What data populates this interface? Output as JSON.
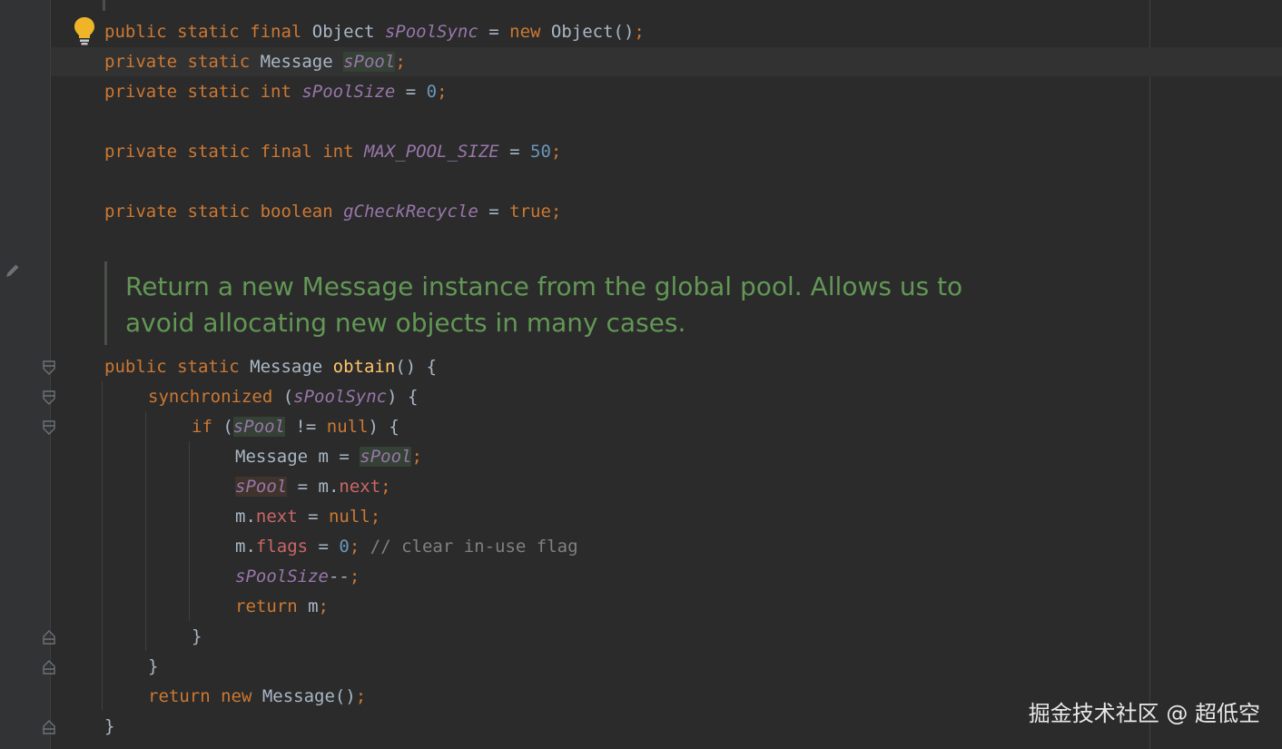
{
  "editor": {
    "theme_colors": {
      "background": "#2b2b2b",
      "keyword": "#cc7832",
      "field": "#9876aa",
      "number": "#6897bb",
      "method": "#ffc66d",
      "doc_comment": "#629755",
      "comment": "#808080"
    },
    "intention_icon": "lightbulb-icon",
    "edit_icon": "pencil-icon",
    "fold_icon": "fold-marker-icon",
    "lines": {
      "l1": {
        "a": "public static final ",
        "b": "Object ",
        "c": "sPoolSync",
        "d": " = ",
        "e": "new ",
        "f": "Object()",
        "g": ";"
      },
      "l2": {
        "a": "private static ",
        "b": "Message ",
        "c": "sPool",
        "d": ";"
      },
      "l3": {
        "a": "private static int ",
        "b": "sPoolSize",
        "c": " = ",
        "d": "0",
        "e": ";"
      },
      "l4": {
        "a": "private static final int ",
        "b": "MAX_POOL_SIZE",
        "c": " = ",
        "d": "50",
        "e": ";"
      },
      "l5": {
        "a": "private static boolean ",
        "b": "gCheckRecycle",
        "c": " = ",
        "d": "true",
        "e": ";"
      },
      "l6": {
        "a": "public static ",
        "b": "Message ",
        "c": "obtain",
        "d": "() {"
      },
      "l7": {
        "a": "synchronized ",
        "b": "(",
        "c": "sPoolSync",
        "d": ") {"
      },
      "l8": {
        "a": "if ",
        "b": "(",
        "c": "sPool",
        "d": " != ",
        "e": "null",
        "f": ") {"
      },
      "l9": {
        "a": "Message m = ",
        "b": "sPool",
        "c": ";"
      },
      "l10": {
        "a": "sPool",
        "b": " = m.",
        "c": "next",
        "d": ";"
      },
      "l11": {
        "a": "m.",
        "b": "next",
        "c": " = ",
        "d": "null",
        "e": ";"
      },
      "l12": {
        "a": "m.",
        "b": "flags",
        "c": " = ",
        "d": "0",
        "e": "; ",
        "f": "// clear in-use flag"
      },
      "l13": {
        "a": "sPoolSize",
        "b": "--",
        "c": ";"
      },
      "l14": {
        "a": "return ",
        "b": "m",
        "c": ";"
      },
      "l15": {
        "a": "}"
      },
      "l16": {
        "a": "}"
      },
      "l17": {
        "a": "return new ",
        "b": "Message()",
        "c": ";"
      },
      "l18": {
        "a": "}"
      }
    },
    "doc_comment": "Return a new Message instance from the global pool. Allows us to avoid allocating new objects in many cases."
  },
  "watermark": "掘金技术社区 @ 超低空"
}
